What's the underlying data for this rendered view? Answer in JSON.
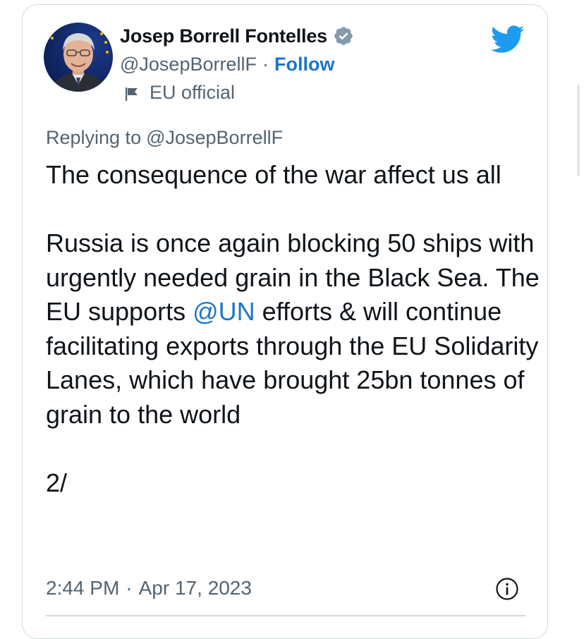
{
  "author": {
    "name": "Josep Borrell Fontelles",
    "handle": "@JosepBorrellF",
    "separator": "·",
    "follow_label": "Follow",
    "label": "EU official",
    "verified": true
  },
  "reply": {
    "prefix": "Replying to",
    "to": "@JosepBorrellF"
  },
  "tweet": {
    "line1": "The consequence of the war affect us all",
    "para2_before": "Russia is once again blocking 50 ships with urgently needed grain in the Black Sea. The EU supports ",
    "para2_mention": "@UN",
    "para2_after": " efforts & will continue facilitating exports through the EU Solidarity Lanes, which have brought 25bn tonnes of grain to the world",
    "line3": "2/"
  },
  "footer": {
    "time": "2:44 PM",
    "separator": "·",
    "date": "Apr 17, 2023"
  },
  "icons": {
    "verified": "verified-badge-icon",
    "flag": "flag-icon",
    "brand": "twitter-bird-icon",
    "info": "info-icon"
  },
  "colors": {
    "accent": "#1d75c9",
    "brand": "#1d9bf0",
    "secondary_text": "#536471",
    "primary_text": "#0f1419",
    "border": "#cfd9de"
  }
}
